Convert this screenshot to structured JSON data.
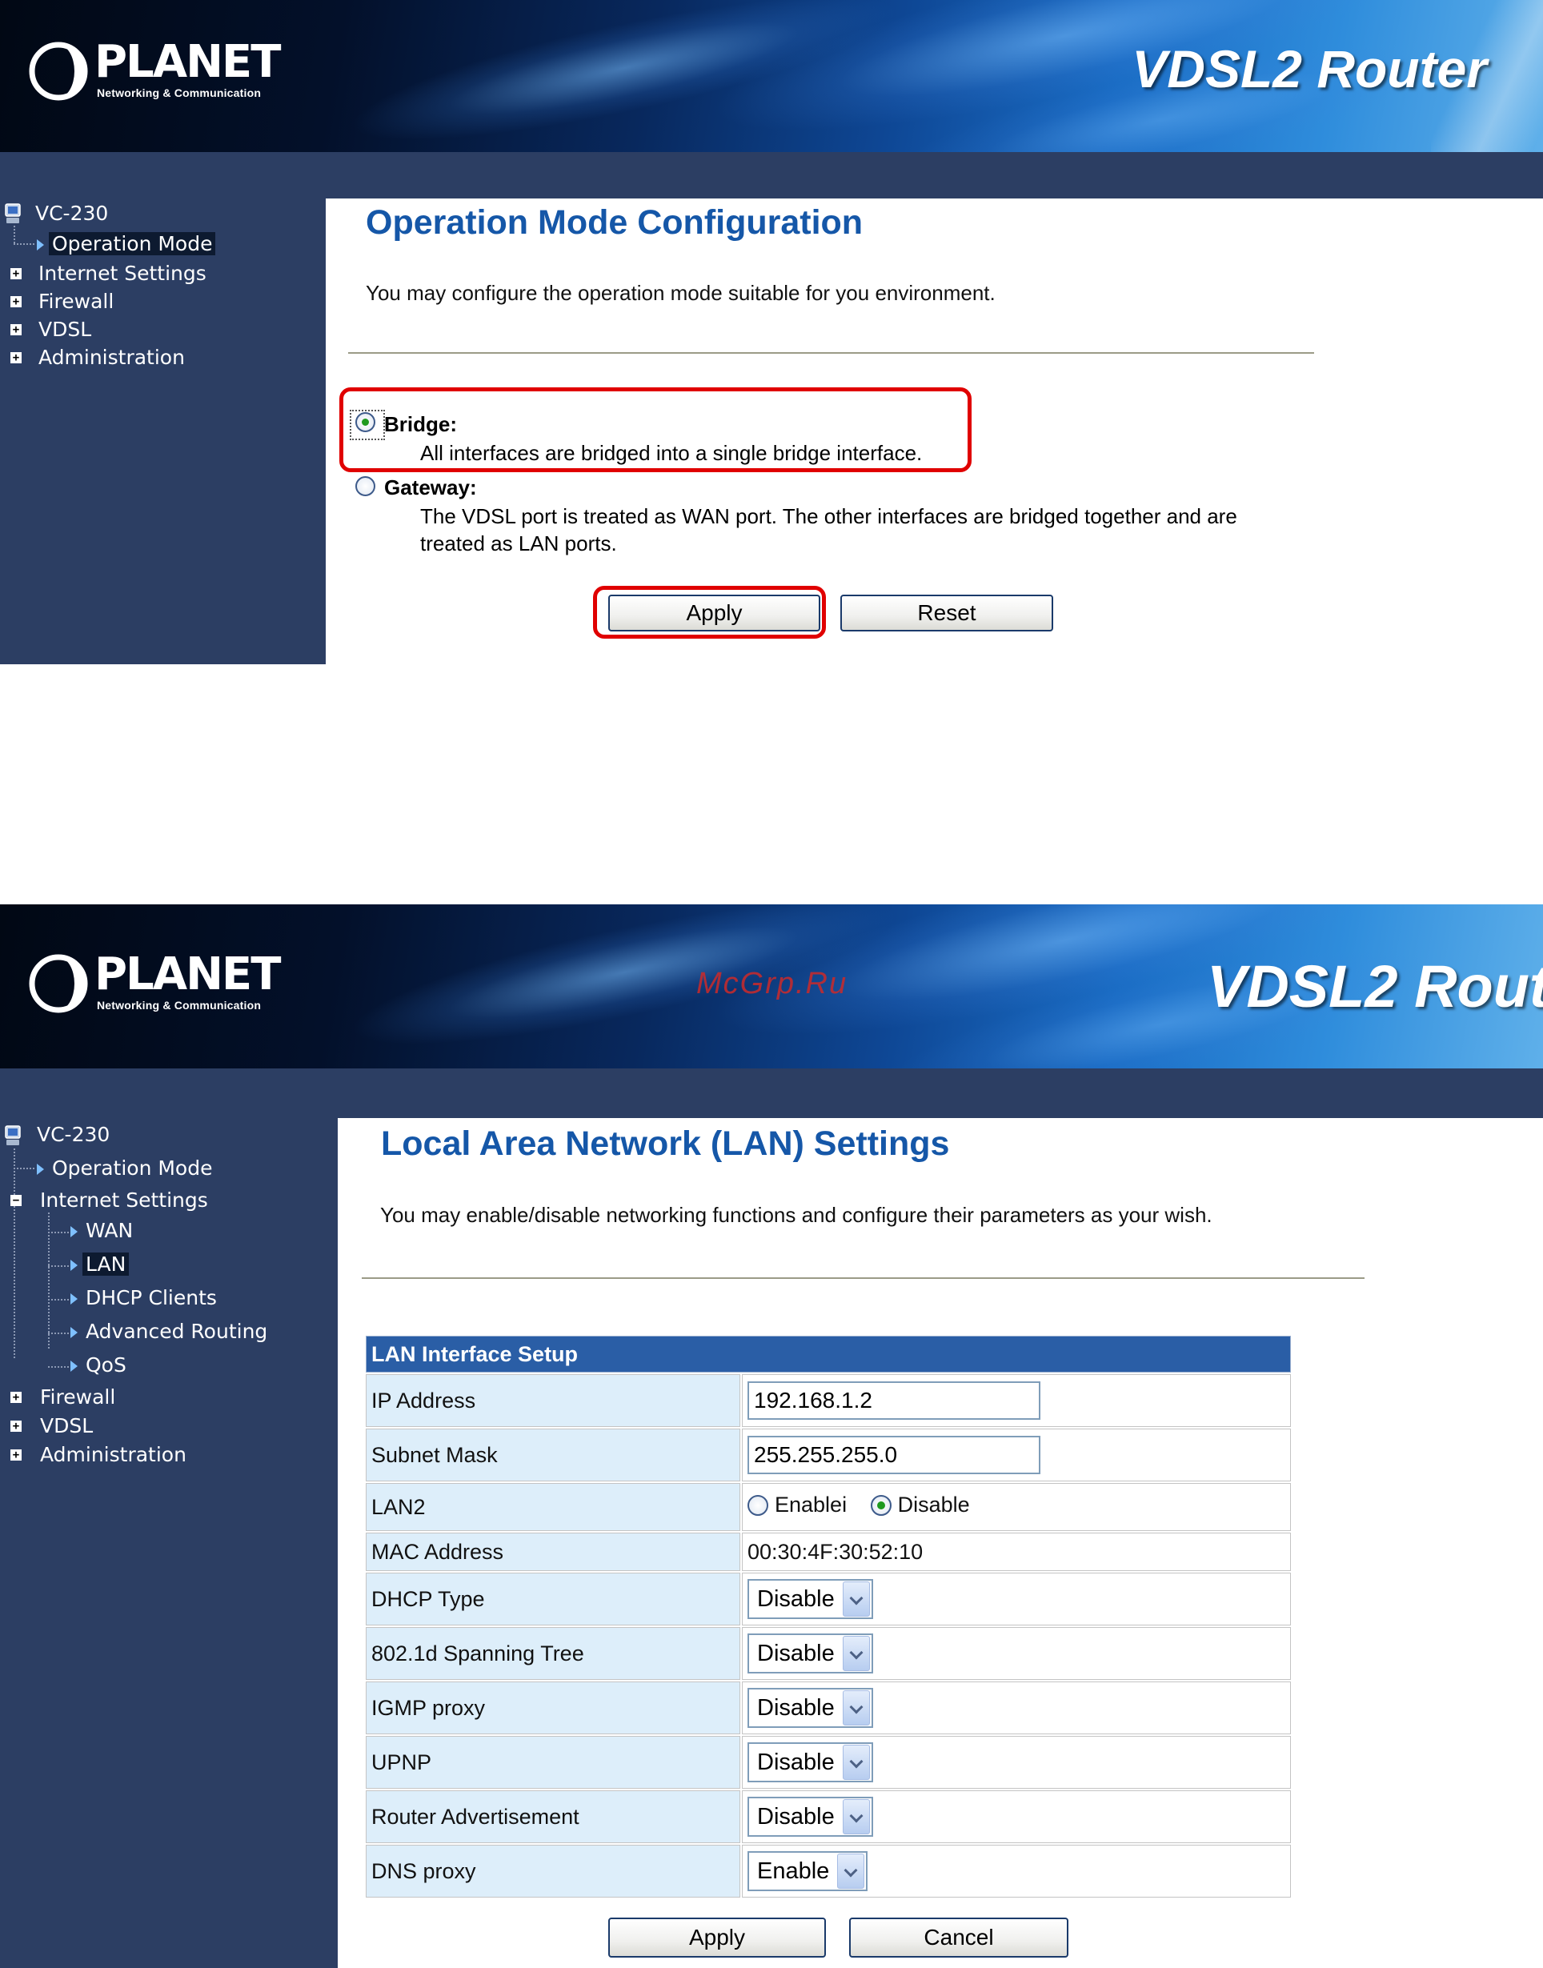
{
  "screens": {
    "op_mode": {
      "brand": {
        "logo_text": "PLANET",
        "tagline": "Networking & Communication",
        "product": "VDSL2 Router"
      },
      "sidebar": {
        "device": "VC-230",
        "items": [
          {
            "label": "Operation Mode",
            "active": true
          },
          {
            "label": "Internet Settings"
          },
          {
            "label": "Firewall"
          },
          {
            "label": "VDSL"
          },
          {
            "label": "Administration"
          }
        ]
      },
      "title": "Operation Mode Configuration",
      "description": "You may configure the operation mode suitable for you environment.",
      "modes": [
        {
          "label": "Bridge:",
          "description": "All interfaces are bridged into a single bridge interface.",
          "selected": true
        },
        {
          "label": "Gateway:",
          "description_line1": "The VDSL port is treated as WAN port. The other interfaces are bridged together and are",
          "description_line2": "treated as LAN ports.",
          "selected": false
        }
      ],
      "buttons": {
        "apply": "Apply",
        "reset": "Reset"
      }
    },
    "lan": {
      "brand": {
        "logo_text": "PLANET",
        "tagline": "Networking & Communication",
        "product": "VDSL2 Router",
        "watermark": "McGrp.Ru"
      },
      "sidebar": {
        "device": "VC-230",
        "items": [
          {
            "label": "Operation Mode"
          },
          {
            "label": "Internet Settings",
            "expanded": true
          },
          {
            "label": "WAN"
          },
          {
            "label": "LAN",
            "active": true
          },
          {
            "label": "DHCP Clients"
          },
          {
            "label": "Advanced Routing"
          },
          {
            "label": "QoS"
          },
          {
            "label": "Firewall"
          },
          {
            "label": "VDSL"
          },
          {
            "label": "Administration"
          }
        ]
      },
      "title": "Local Area Network (LAN) Settings",
      "description": "You may enable/disable networking functions and configure their parameters as your wish.",
      "table": {
        "header": "LAN Interface Setup",
        "rows": {
          "ip_address": {
            "label": "IP Address",
            "value": "192.168.1.2"
          },
          "subnet_mask": {
            "label": "Subnet Mask",
            "value": "255.255.255.0"
          },
          "lan2": {
            "label": "LAN2",
            "option_enable": "Enablei",
            "option_disable": "Disable",
            "selected": "Disable"
          },
          "mac_address": {
            "label": "MAC Address",
            "value": "00:30:4F:30:52:10"
          },
          "dhcp_type": {
            "label": "DHCP Type",
            "value": "Disable"
          },
          "spanning_tree": {
            "label": "802.1d Spanning Tree",
            "value": "Disable"
          },
          "igmp_proxy": {
            "label": "IGMP proxy",
            "value": "Disable"
          },
          "upnp": {
            "label": "UPNP",
            "value": "Disable"
          },
          "router_adv": {
            "label": "Router Advertisement",
            "value": "Disable"
          },
          "dns_proxy": {
            "label": "DNS proxy",
            "value": "Enable"
          }
        }
      },
      "buttons": {
        "apply": "Apply",
        "cancel": "Cancel"
      }
    }
  },
  "colors": {
    "sidebar_bg": "#2c3e63",
    "title_blue": "#1557a8",
    "table_header": "#2a5ea6",
    "highlight_red": "#e00000"
  }
}
